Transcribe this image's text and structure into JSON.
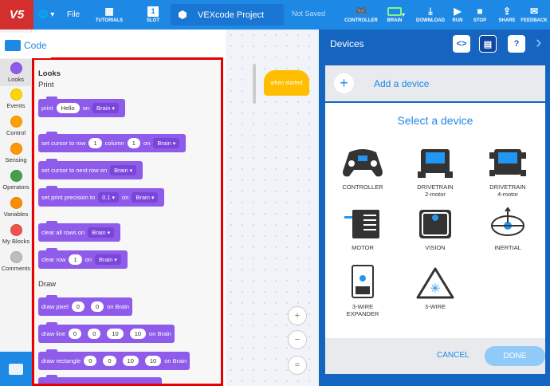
{
  "topbar": {
    "logo": "V5",
    "file": "File",
    "tutorials": "TUTORIALS",
    "slot": "SLOT",
    "slot_number": "1",
    "project_name": "VEXcode Project",
    "save_status": "Not Saved",
    "controller": "CONTROLLER",
    "brain": "BRAIN",
    "download": "DOWNLOAD",
    "run": "RUN",
    "stop": "STOP",
    "share": "SHARE",
    "feedback": "FEEDBACK"
  },
  "code_tab": "Code",
  "categories": [
    {
      "label": "Looks",
      "color": "#8e5bea"
    },
    {
      "label": "Events",
      "color": "#ffd500"
    },
    {
      "label": "Control",
      "color": "#ffa000"
    },
    {
      "label": "Sensing",
      "color": "#ff9800"
    },
    {
      "label": "Operators",
      "color": "#43a047"
    },
    {
      "label": "Variables",
      "color": "#fb8c00"
    },
    {
      "label": "My Blocks",
      "color": "#ef5350"
    },
    {
      "label": "Comments",
      "color": "#bdbdbd"
    }
  ],
  "palette": {
    "heading": "Looks",
    "print_section": "Print",
    "draw_section": "Draw",
    "blocks": {
      "print": {
        "text": "print",
        "value": "Hello",
        "on": "on",
        "target": "Brain"
      },
      "set_cursor": {
        "text": "set cursor to row",
        "row": "1",
        "column_label": "column",
        "column": "1",
        "on": "on",
        "target": "Brain"
      },
      "next_row": {
        "text": "set cursor to next row on",
        "target": "Brain"
      },
      "precision": {
        "text": "set print precision to",
        "value": "0.1",
        "on": "on",
        "target": "Brain"
      },
      "clear_all": {
        "text": "clear all rows on",
        "target": "Brain"
      },
      "clear_row": {
        "text": "clear row",
        "value": "1",
        "on": "on",
        "target": "Brain"
      },
      "draw_pixel": {
        "text": "draw pixel",
        "x": "0",
        "y": "0",
        "on": "on Brain"
      },
      "draw_line": {
        "text": "draw line",
        "v1": "0",
        "v2": "0",
        "v3": "10",
        "v4": "10",
        "on": "on Brain"
      },
      "draw_rect": {
        "text": "draw rectangle",
        "v1": "0",
        "v2": "0",
        "v3": "10",
        "v4": "10",
        "on": "on Brain"
      }
    }
  },
  "workspace": {
    "hat_block": "when started",
    "zoom_in": "+",
    "zoom_out": "−",
    "zoom_reset": "="
  },
  "devices": {
    "title": "Devices",
    "add_device": "Add a device",
    "select_title": "Select a device",
    "items": [
      {
        "label": "CONTROLLER",
        "sub": ""
      },
      {
        "label": "DRIVETRAIN",
        "sub": "2-motor"
      },
      {
        "label": "DRIVETRAIN",
        "sub": "4-motor"
      },
      {
        "label": "MOTOR",
        "sub": ""
      },
      {
        "label": "VISION",
        "sub": ""
      },
      {
        "label": "INERTIAL",
        "sub": ""
      },
      {
        "label": "3-WIRE",
        "sub": "EXPANDER"
      },
      {
        "label": "3-WIRE",
        "sub": ""
      }
    ],
    "cancel": "CANCEL",
    "done": "DONE"
  }
}
